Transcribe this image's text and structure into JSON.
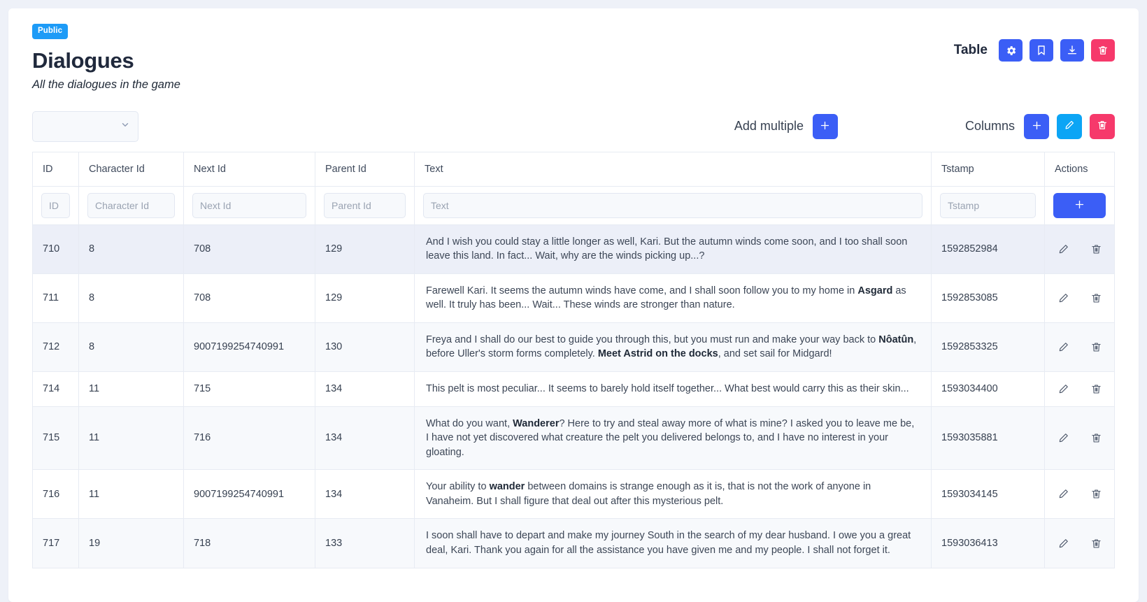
{
  "header": {
    "badge": "Public",
    "title": "Dialogues",
    "subtitle": "All the dialogues in the game",
    "view_label": "Table",
    "actions": [
      {
        "name": "settings",
        "icon": "gear-icon",
        "color": "#3b5ef6"
      },
      {
        "name": "bookmark",
        "icon": "bookmark-icon",
        "color": "#3b5ef6"
      },
      {
        "name": "download",
        "icon": "download-icon",
        "color": "#3b5ef6"
      },
      {
        "name": "delete",
        "icon": "trash-icon",
        "color": "#f6396b"
      }
    ]
  },
  "toolbar": {
    "select_value": "",
    "select_placeholder": "",
    "add_multiple_label": "Add multiple",
    "add_multiple_icon": "plus-icon",
    "columns_label": "Columns",
    "columns_add_icon": "plus-icon",
    "columns_edit_icon": "pencil-icon",
    "columns_delete_icon": "trash-icon"
  },
  "table": {
    "columns": [
      {
        "key": "id",
        "label": "ID",
        "placeholder": "ID"
      },
      {
        "key": "character",
        "label": "Character Id",
        "placeholder": "Character Id"
      },
      {
        "key": "next",
        "label": "Next Id",
        "placeholder": "Next Id"
      },
      {
        "key": "parent",
        "label": "Parent Id",
        "placeholder": "Parent Id"
      },
      {
        "key": "text",
        "label": "Text",
        "placeholder": "Text"
      },
      {
        "key": "tstamp",
        "label": "Tstamp",
        "placeholder": "Tstamp"
      },
      {
        "key": "actions",
        "label": "Actions",
        "placeholder": ""
      }
    ],
    "add_row_icon": "plus-icon",
    "row_edit_icon": "pencil-icon",
    "row_delete_icon": "trash-icon",
    "rows": [
      {
        "id": "710",
        "character": "8",
        "next": "708",
        "parent": "129",
        "text_html": "And I wish you could stay a little longer as well, Kari. But the autumn winds come soon, and I too shall soon leave this land. In fact... Wait, why are the winds picking up...?",
        "tstamp": "1592852984",
        "highlight": true
      },
      {
        "id": "711",
        "character": "8",
        "next": "708",
        "parent": "129",
        "text_html": "Farewell Kari. It seems the autumn winds have come, and I shall soon follow you to my home in <b>Asgard</b> as well. It truly has been... Wait... These winds are stronger than nature.",
        "tstamp": "1592853085",
        "highlight": false
      },
      {
        "id": "712",
        "character": "8",
        "next": "9007199254740991",
        "parent": "130",
        "text_html": "Freya and I shall do our best to guide you through this, but you must run and make your way back to <b>Nôatûn</b>, before Uller's storm forms completely. <b>Meet Astrid on the docks</b>, and set sail for Midgard!",
        "tstamp": "1592853325",
        "highlight": false
      },
      {
        "id": "714",
        "character": "11",
        "next": "715",
        "parent": "134",
        "text_html": "This pelt is most peculiar... It seems to barely hold itself together... What best would carry this as their skin...",
        "tstamp": "1593034400",
        "highlight": false
      },
      {
        "id": "715",
        "character": "11",
        "next": "716",
        "parent": "134",
        "text_html": "What do you want, <b>Wanderer</b>? Here to try and steal away more of what is mine? I asked you to leave me be, I have not yet discovered what creature the pelt you delivered belongs to, and I have no interest in your gloating.",
        "tstamp": "1593035881",
        "highlight": false
      },
      {
        "id": "716",
        "character": "11",
        "next": "9007199254740991",
        "parent": "134",
        "text_html": "Your ability to <b>wander</b> between domains is strange enough as it is, that is not the work of anyone in Vanaheim. But I shall figure that deal out after this mysterious pelt.",
        "tstamp": "1593034145",
        "highlight": false
      },
      {
        "id": "717",
        "character": "19",
        "next": "718",
        "parent": "133",
        "text_html": "I soon shall have to depart and make my journey South in the search of my dear husband. I owe you a great deal, Kari. Thank you again for all the assistance you have given me and my people. I shall not forget it.",
        "tstamp": "1593036413",
        "highlight": false
      }
    ]
  },
  "colors": {
    "page_bg": "#eef1f8",
    "card_bg": "#ffffff",
    "badge": "#1d9bf7",
    "primary": "#3b5ef6",
    "cyan": "#0ca5f5",
    "danger": "#f6396b",
    "row_alt": "#f7f9fc",
    "row_highlight": "#eceff8",
    "border": "#e7ebf3"
  }
}
